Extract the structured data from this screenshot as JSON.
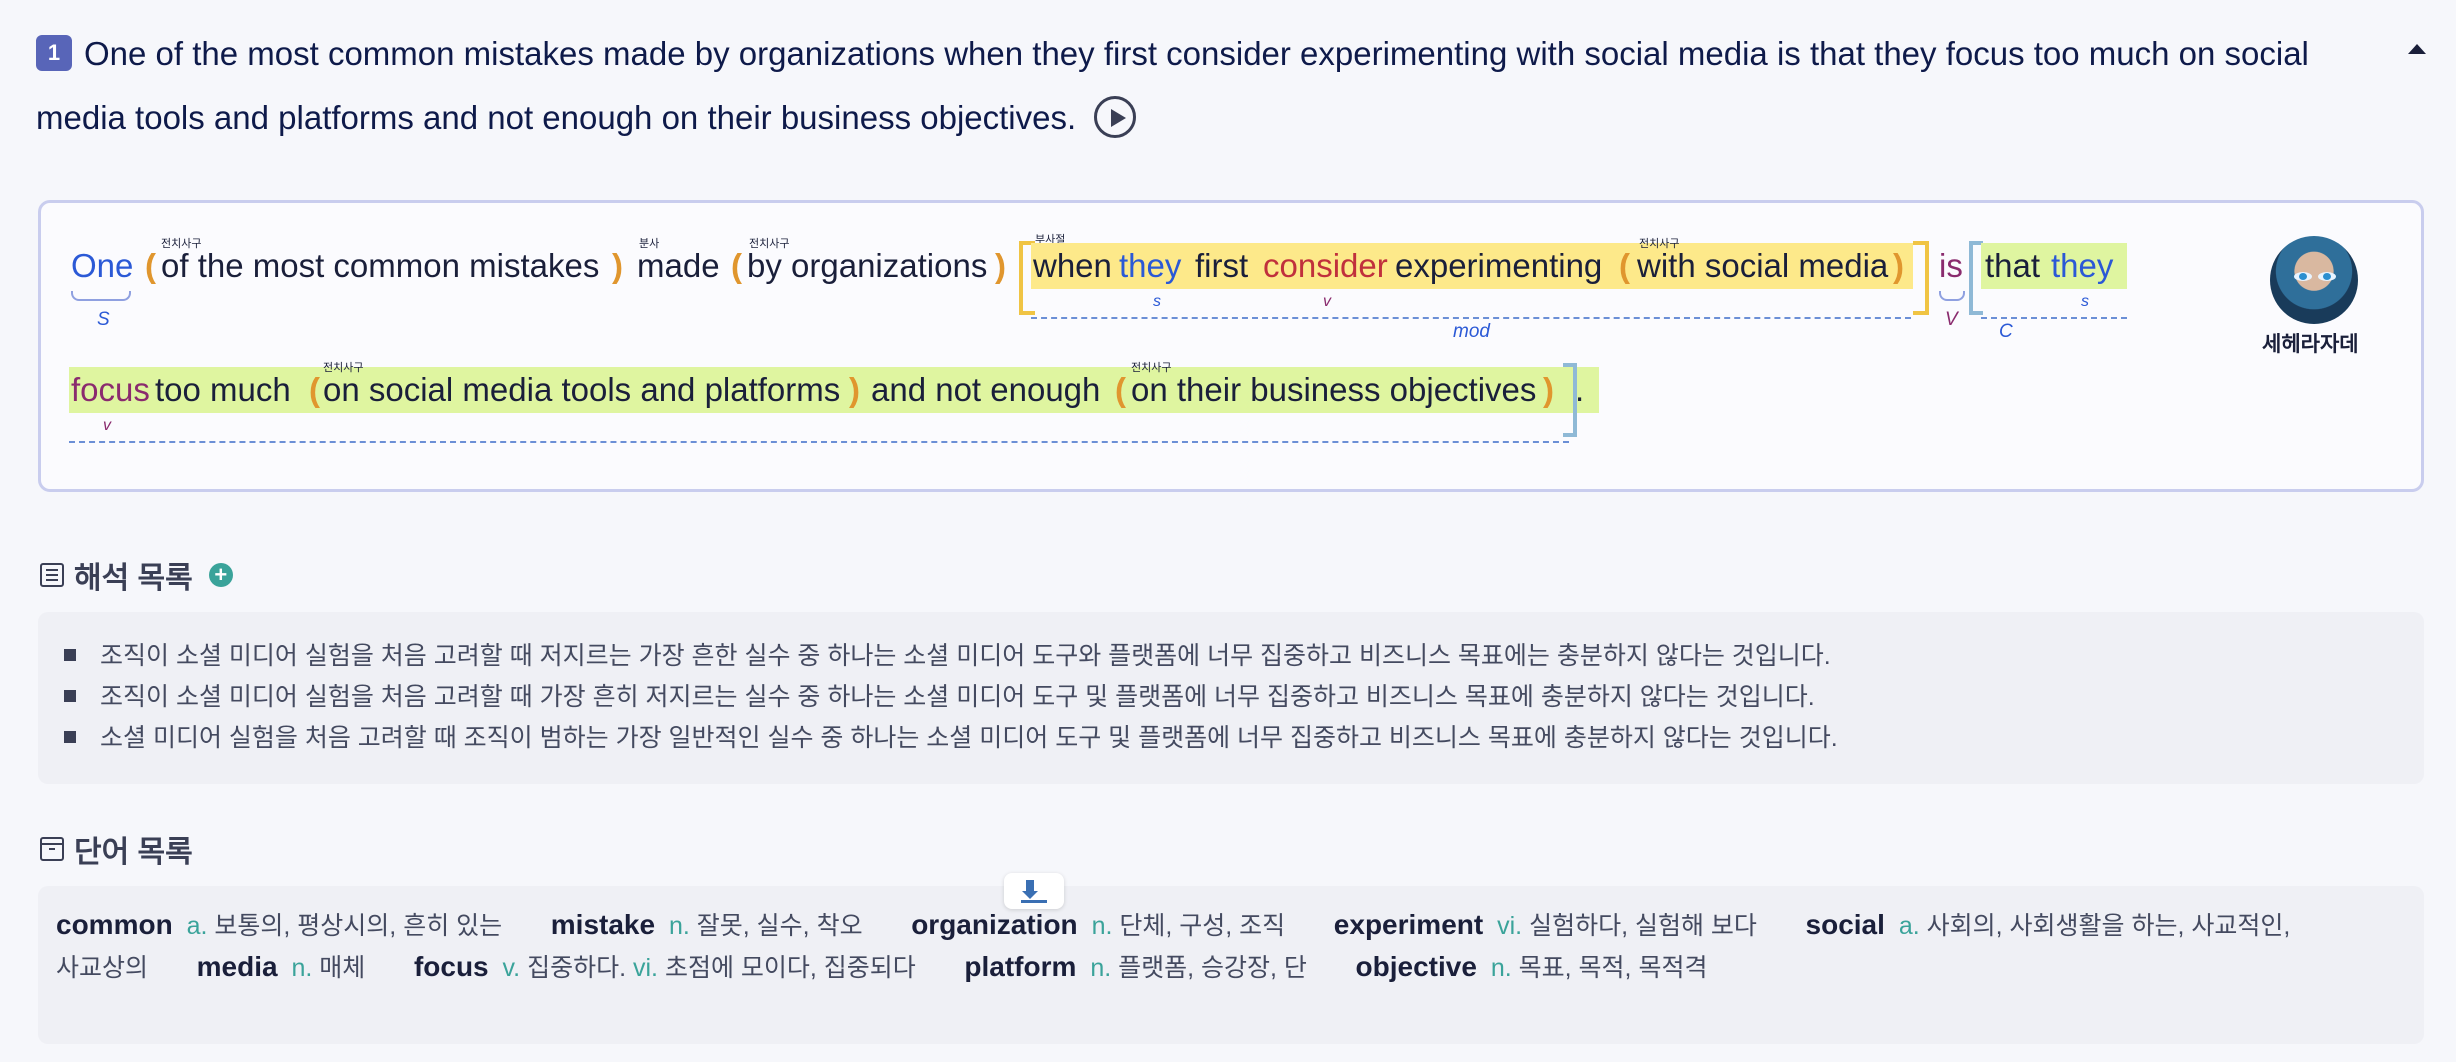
{
  "question": {
    "number": "1",
    "text": "One of the most common mistakes made by organizations when they first consider experimenting with social media is that they focus too much on social media tools and platforms and not enough on their business objectives."
  },
  "analysis": {
    "line1": {
      "one": "One",
      "p1": "of the most common mistakes",
      "made": "made",
      "p2": "by organizations",
      "when": "when",
      "they": "they",
      "first": "first",
      "consider": "consider",
      "experimenting": "experimenting",
      "p3": "with social media",
      "is": "is",
      "that": "that",
      "they2": "they"
    },
    "line2": {
      "focus": "focus",
      "toomuch": "too much",
      "p4": "on social media tools and platforms",
      "and": "and not enough",
      "p5": "on their business objectives",
      "period": "."
    },
    "tags": {
      "prep_phrase": "전치사구",
      "participle": "분사",
      "adverb_clause": "부사절"
    },
    "roles": {
      "S": "S",
      "s": "s",
      "v": "v",
      "V": "V",
      "C": "C",
      "mod": "mod"
    },
    "tutor_name": "세헤라자데"
  },
  "translation": {
    "title": "해석 목록",
    "items": [
      "조직이 소셜 미디어 실험을 처음 고려할 때 저지르는 가장 흔한 실수 중 하나는 소셜 미디어 도구와 플랫폼에 너무 집중하고 비즈니스 목표에는 충분하지 않다는 것입니다.",
      "조직이 소셜 미디어 실험을 처음 고려할 때 가장 흔히 저지르는 실수 중 하나는 소셜 미디어 도구 및 플랫폼에 너무 집중하고 비즈니스 목표에 충분하지 않다는 것입니다.",
      "소셜 미디어 실험을 처음 고려할 때 조직이 범하는 가장 일반적인 실수 중 하나는 소셜 미디어 도구 및 플랫폼에 너무 집중하고 비즈니스 목표에 충분하지 않다는 것입니다."
    ]
  },
  "vocab": {
    "title": "단어 목록",
    "words": [
      {
        "word": "common",
        "pos": "a.",
        "meaning": "보통의, 평상시의, 흔히 있는"
      },
      {
        "word": "mistake",
        "pos": "n.",
        "meaning": "잘못, 실수, 착오"
      },
      {
        "word": "organization",
        "pos": "n.",
        "meaning": "단체, 구성, 조직"
      },
      {
        "word": "experiment",
        "pos": "vi.",
        "meaning": "실험하다, 실험해 보다"
      },
      {
        "word": "social",
        "pos": "a.",
        "meaning": "사회의, 사회생활을 하는, 사교적인,"
      },
      {
        "word": "",
        "pos": "",
        "meaning": "사교상의"
      },
      {
        "word": "media",
        "pos": "n.",
        "meaning": "매체"
      },
      {
        "word": "focus",
        "pos": "v.",
        "meaning": "집중하다.",
        "pos2": "vi.",
        "meaning2": "초점에 모이다, 집중되다"
      },
      {
        "word": "platform",
        "pos": "n.",
        "meaning": "플랫폼, 승강장, 단"
      },
      {
        "word": "objective",
        "pos": "n.",
        "meaning": "목표, 목적, 목적격"
      }
    ]
  }
}
